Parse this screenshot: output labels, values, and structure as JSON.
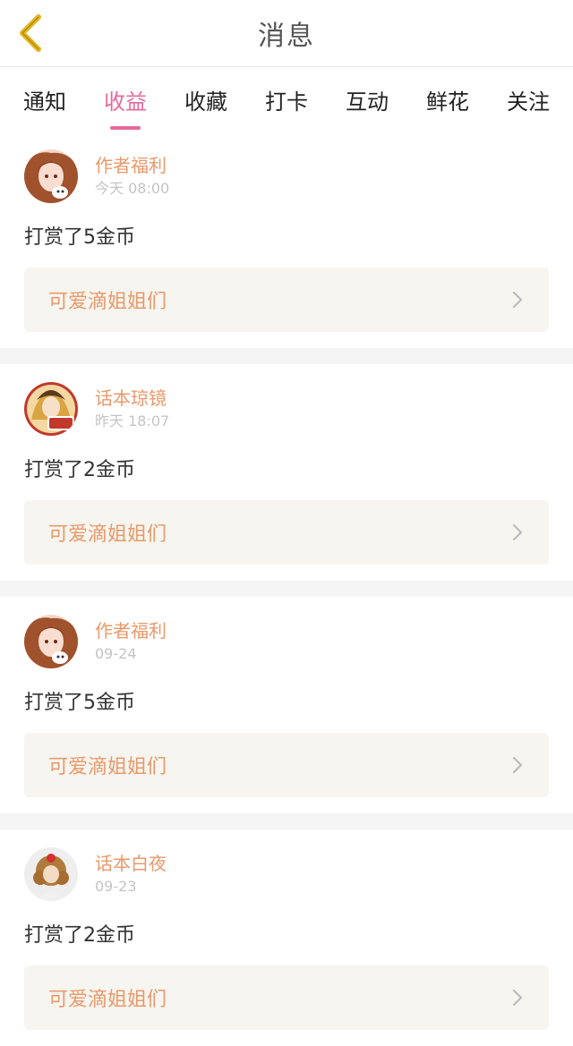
{
  "header": {
    "title": "消息",
    "back_icon": "chevron-left-icon",
    "back_color": "#e2b41e"
  },
  "tabs": [
    {
      "label": "通知",
      "active": false
    },
    {
      "label": "收益",
      "active": true
    },
    {
      "label": "收藏",
      "active": false
    },
    {
      "label": "打卡",
      "active": false
    },
    {
      "label": "互动",
      "active": false
    },
    {
      "label": "鲜花",
      "active": false
    },
    {
      "label": "关注",
      "active": false
    }
  ],
  "colors": {
    "accent": "#e46a9c",
    "name": "#e9996b",
    "link_bg": "#f6f5ef"
  },
  "messages": [
    {
      "avatar": "anime-girl-avatar",
      "name": "作者福利",
      "time": "今天 08:00",
      "action": "打赏了5金币",
      "target": "可爱滴姐姐们"
    },
    {
      "avatar": "qiongjing-avatar",
      "name": "话本琼镜",
      "time": "昨天 18:07",
      "action": "打赏了2金币",
      "target": "可爱滴姐姐们"
    },
    {
      "avatar": "anime-girl-avatar",
      "name": "作者福利",
      "time": "09-24",
      "action": "打赏了5金币",
      "target": "可爱滴姐姐们"
    },
    {
      "avatar": "curly-hair-avatar",
      "name": "话本白夜",
      "time": "09-23",
      "action": "打赏了2金币",
      "target": "可爱滴姐姐们"
    }
  ]
}
